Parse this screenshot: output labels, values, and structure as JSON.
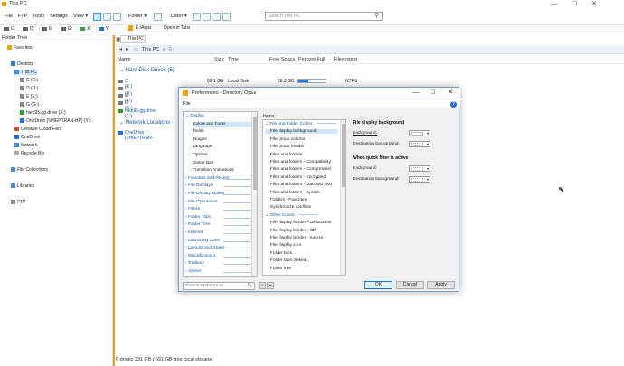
{
  "window": {
    "title": "This PC",
    "controls": [
      "—",
      "☐",
      "✕"
    ]
  },
  "menu": [
    "File",
    "FTP",
    "Tools",
    "Settings",
    "View ▾"
  ],
  "toolbar": {
    "folder_label": "Folder ▾",
    "lister_label": "Lister ▾",
    "search_placeholder": "Search This PC"
  },
  "drives": [
    "C:",
    "D:",
    "E:",
    "G:",
    "X:",
    "Y:"
  ],
  "tabbar": {
    "path": "E:\\Apps",
    "open_in_tabs": "Open in Tabs"
  },
  "tree": {
    "header": "Folder Tree",
    "items": [
      "Favorites",
      "Desktop",
      "This PC",
      "C (C:)",
      "D (D:)",
      "E (E:)",
      "G (G:)",
      "hiep95.gg.drive (X:)",
      "OneDrive (\\\\HIEPTRAN-HP) (Y:)",
      "Creative Cloud Files",
      "OneDrive",
      "Network",
      "Recycle Bin",
      "File Collections",
      "Libraries",
      "FTP"
    ]
  },
  "lister": {
    "tab": "This PC",
    "address": [
      "This PC",
      "E:"
    ],
    "columns": [
      "Name",
      "Size",
      "Type",
      "Free Space",
      "Percent Full",
      "Filesystem"
    ],
    "group1": "Hard Disk Drives (5)",
    "group2": "Network Locations",
    "rows": [
      {
        "name": "C (C:)",
        "size": "99.1 GB",
        "type": "Local Disk",
        "free": "59.9 GB",
        "pct": 0.4,
        "fs": "NTFS"
      },
      {
        "name": "D (D:)",
        "size": "",
        "type": "",
        "free": "",
        "pct": null,
        "fs": ""
      },
      {
        "name": "E (E:)",
        "size": "",
        "type": "",
        "free": "",
        "pct": null,
        "fs": ""
      },
      {
        "name": "G (G:)",
        "size": "",
        "type": "",
        "free": "",
        "pct": null,
        "fs": ""
      },
      {
        "name": "hiep95.gg.drive (X:)",
        "size": "",
        "type": "",
        "free": "",
        "pct": null,
        "fs": ""
      },
      {
        "name": "OneDrive (\\\\HIEPTRAN-",
        "size": "",
        "type": "",
        "free": "",
        "pct": null,
        "fs": ""
      }
    ],
    "status": "6 drives 331 GB / 591 GB free local storage"
  },
  "dialog": {
    "title": "Preferences - Directory Opus",
    "menu_file": "File",
    "help": "?",
    "categories": [
      {
        "label": "Display",
        "kind": "group",
        "open": true
      },
      {
        "label": "Colors and Fonts",
        "kind": "sub",
        "selected": true
      },
      {
        "label": "Fields",
        "kind": "sub"
      },
      {
        "label": "Images",
        "kind": "sub"
      },
      {
        "label": "Language",
        "kind": "sub"
      },
      {
        "label": "Options",
        "kind": "sub"
      },
      {
        "label": "Status Bar",
        "kind": "sub"
      },
      {
        "label": "Transition Animations",
        "kind": "sub"
      },
      {
        "label": "Favorites and Recent",
        "kind": "group"
      },
      {
        "label": "File Displays",
        "kind": "group"
      },
      {
        "label": "File Display Modes",
        "kind": "group"
      },
      {
        "label": "File Operations",
        "kind": "group"
      },
      {
        "label": "Filters",
        "kind": "group"
      },
      {
        "label": "Folder Tabs",
        "kind": "group"
      },
      {
        "label": "Folder Tree",
        "kind": "group"
      },
      {
        "label": "Internet",
        "kind": "group"
      },
      {
        "label": "Launching Opus",
        "kind": "group"
      },
      {
        "label": "Layouts and Styles",
        "kind": "group"
      },
      {
        "label": "Miscellaneous",
        "kind": "group"
      },
      {
        "label": "Toolbars",
        "kind": "group"
      },
      {
        "label": "Viewer",
        "kind": "group"
      }
    ],
    "items_label": "Items:",
    "items": [
      {
        "label": "File and Folder Colors",
        "kind": "group"
      },
      {
        "label": "File display background",
        "kind": "item",
        "selected": true
      },
      {
        "label": "File group column",
        "kind": "item"
      },
      {
        "label": "File group header",
        "kind": "item"
      },
      {
        "label": "Files and folders",
        "kind": "item"
      },
      {
        "label": "Files and folders - Compatibility",
        "kind": "item"
      },
      {
        "label": "Files and folders - Compressed",
        "kind": "item"
      },
      {
        "label": "Files and folders - Encrypted",
        "kind": "item"
      },
      {
        "label": "Files and folders - Matched Text",
        "kind": "item"
      },
      {
        "label": "Files and folders - System",
        "kind": "item"
      },
      {
        "label": "Folders - Favorites",
        "kind": "item"
      },
      {
        "label": "Synchronize conflicts",
        "kind": "item"
      },
      {
        "label": "Other Colors",
        "kind": "group"
      },
      {
        "label": "File display border - Destination",
        "kind": "item"
      },
      {
        "label": "File display border - Off",
        "kind": "item"
      },
      {
        "label": "File display border - Source",
        "kind": "item"
      },
      {
        "label": "File display icon",
        "kind": "item"
      },
      {
        "label": "Folder tabs",
        "kind": "item"
      },
      {
        "label": "Folder tabs (linked)",
        "kind": "item"
      },
      {
        "label": "Folder tree",
        "kind": "item"
      }
    ],
    "right": {
      "heading1": "File display background",
      "background": "Background:",
      "destination_bg": "Destination background:",
      "heading2": "When quick filter is active",
      "background2": "Background:",
      "destination_bg2": "Destination background:"
    },
    "search_placeholder": "Search Preferences",
    "buttons": {
      "ok": "OK",
      "cancel": "Cancel",
      "apply": "Apply"
    }
  }
}
